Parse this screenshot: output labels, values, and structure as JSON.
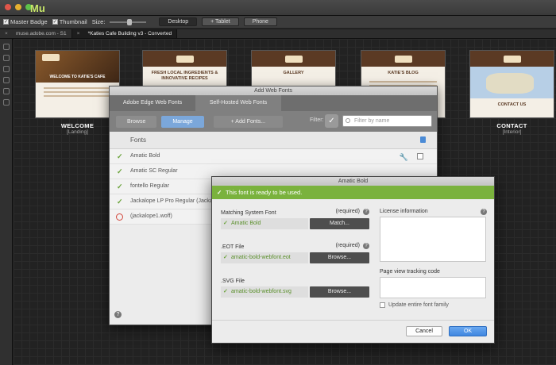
{
  "app": {
    "name": "Mu"
  },
  "colors": {
    "accent": "#7ab23d",
    "primary_button": "#3f86e0",
    "dark_chrome": "#3c3c3c"
  },
  "toolbar": {
    "master_badge": "Master Badge",
    "thumbnail": "Thumbnail",
    "size_label": "Size:",
    "views": [
      "Desktop",
      "+ Tablet",
      "Phone"
    ]
  },
  "tabs": [
    {
      "label": "muse.adobe.com - S1"
    },
    {
      "label": "*Katies Cafe Building v3 - Converted"
    }
  ],
  "pages": [
    {
      "name": "WELCOME",
      "type": "[Landing]",
      "headline": "WELCOME TO KATIE'S CAFE"
    },
    {
      "name": "",
      "type": "",
      "headline": "FRESH LOCAL INGREDIENTS & INNOVATIVE RECIPES"
    },
    {
      "name": "",
      "type": "",
      "headline": "GALLERY"
    },
    {
      "name": "",
      "type": "",
      "headline": "KATIE'S BLOG"
    },
    {
      "name": "CONTACT",
      "type": "[Interior]",
      "headline": "CONTACT US"
    }
  ],
  "fonts_panel": {
    "title": "Add Web Fonts",
    "tabs": [
      "Adobe Edge Web Fonts",
      "Self-Hosted Web Fonts"
    ],
    "sub_buttons": {
      "browse": "Browse",
      "manage": "Manage",
      "add": "+ Add Fonts..."
    },
    "filter_label": "Filter:",
    "filter_placeholder": "Filter by name",
    "list_header": "Fonts",
    "fonts": [
      {
        "name": "Amatic Bold",
        "status": "ok"
      },
      {
        "name": "Amatic SC Regular",
        "status": "ok"
      },
      {
        "name": "fontello Regular",
        "status": "ok"
      },
      {
        "name": "Jackalope LP Pro Regular (Jackalope",
        "status": "ok"
      },
      {
        "name": "(jackalope1.woff)",
        "status": "error"
      }
    ]
  },
  "dialog": {
    "title": "Amatic Bold",
    "banner": "This font is ready to be used.",
    "required": "(required)",
    "matching_label": "Matching System Font",
    "matching_value": "Amatic Bold",
    "match_button": "Match...",
    "eot_label": ".EOT File",
    "eot_value": "amatic-bold-webfont.eot",
    "svg_label": ".SVG File",
    "svg_value": "amatic-bold-webfont.svg",
    "browse_button": "Browse...",
    "license_label": "License information",
    "tracking_label": "Page view tracking code",
    "update_label": "Update entire font family",
    "cancel": "Cancel",
    "ok": "OK"
  }
}
